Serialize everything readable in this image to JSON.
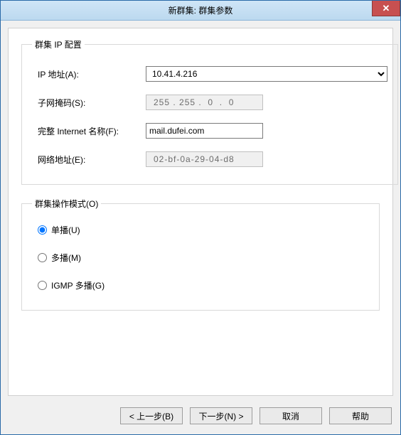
{
  "window": {
    "title": "新群集: 群集参数",
    "close_glyph": "✕"
  },
  "group_ip": {
    "legend": "群集 IP 配置",
    "ip_label": "IP 地址(A):",
    "ip_value": "10.41.4.216",
    "subnet_label": "子网掩码(S):",
    "subnet_value": "255 . 255 .  0  .  0",
    "fullname_label": "完整 Internet 名称(F):",
    "fullname_value": "mail.dufei.com",
    "mac_label": "网络地址(E):",
    "mac_value": "02-bf-0a-29-04-d8"
  },
  "mode": {
    "legend": "群集操作模式(O)",
    "unicast_label": "单播(U)",
    "multicast_label": "多播(M)",
    "igmp_label": "IGMP 多播(G)",
    "selected": "unicast"
  },
  "buttons": {
    "back": "< 上一步(B)",
    "next": "下一步(N) >",
    "cancel": "取消",
    "help": "帮助"
  }
}
